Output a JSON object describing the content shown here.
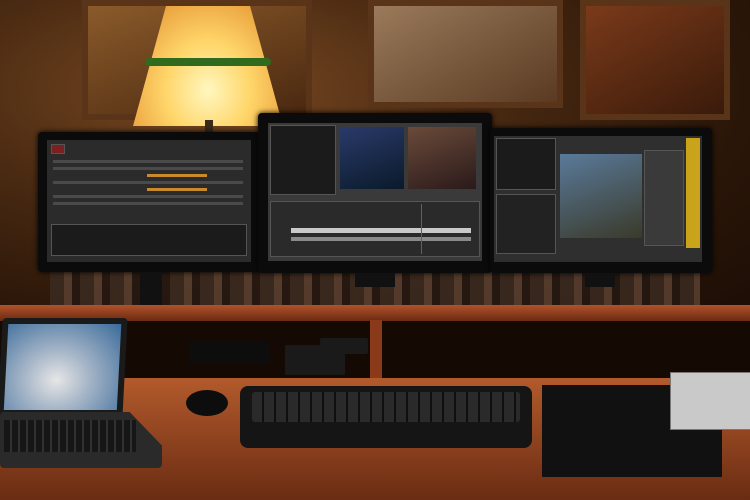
{
  "scene": {
    "description_tags": [
      "video-editing-workstation"
    ],
    "colors": {
      "wall_warm": "#4a2a12",
      "desk_wood": "#b25a2c",
      "screen_dark": "#1f1f1f",
      "highlight_orange": "#c98a2a"
    }
  }
}
